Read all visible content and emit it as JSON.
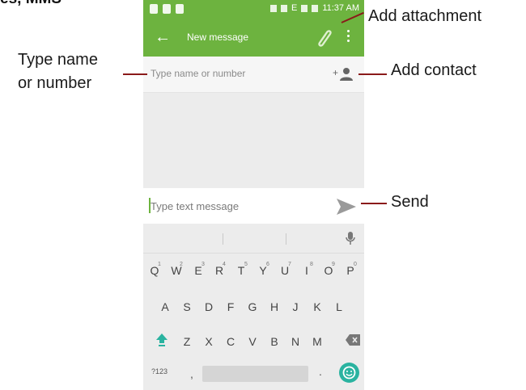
{
  "heading": "es, MMS",
  "status_bar": {
    "time": "11:37 AM",
    "network": "E"
  },
  "app_bar": {
    "title": "New message"
  },
  "recipient": {
    "placeholder": "Type name or number"
  },
  "compose": {
    "placeholder": "Type text message"
  },
  "keyboard": {
    "row1": [
      {
        "letter": "Q",
        "hint": "1"
      },
      {
        "letter": "W",
        "hint": "2"
      },
      {
        "letter": "E",
        "hint": "3"
      },
      {
        "letter": "R",
        "hint": "4"
      },
      {
        "letter": "T",
        "hint": "5"
      },
      {
        "letter": "Y",
        "hint": "6"
      },
      {
        "letter": "U",
        "hint": "7"
      },
      {
        "letter": "I",
        "hint": "8"
      },
      {
        "letter": "O",
        "hint": "9"
      },
      {
        "letter": "P",
        "hint": "0"
      }
    ],
    "row2": [
      "A",
      "S",
      "D",
      "F",
      "G",
      "H",
      "J",
      "K",
      "L"
    ],
    "row3": [
      "Z",
      "X",
      "C",
      "V",
      "B",
      "N",
      "M"
    ],
    "symbols_key": "?123",
    "comma_key": ",",
    "period_key": "."
  },
  "callouts": {
    "attachment": "Add attachment",
    "contact": "Add contact",
    "name_line1": "Type name",
    "name_line2": "or number",
    "send": "Send"
  },
  "colors": {
    "accent": "#6db33f",
    "callout_line": "#8a1a1a",
    "emoji_key": "#2ab3a0"
  }
}
